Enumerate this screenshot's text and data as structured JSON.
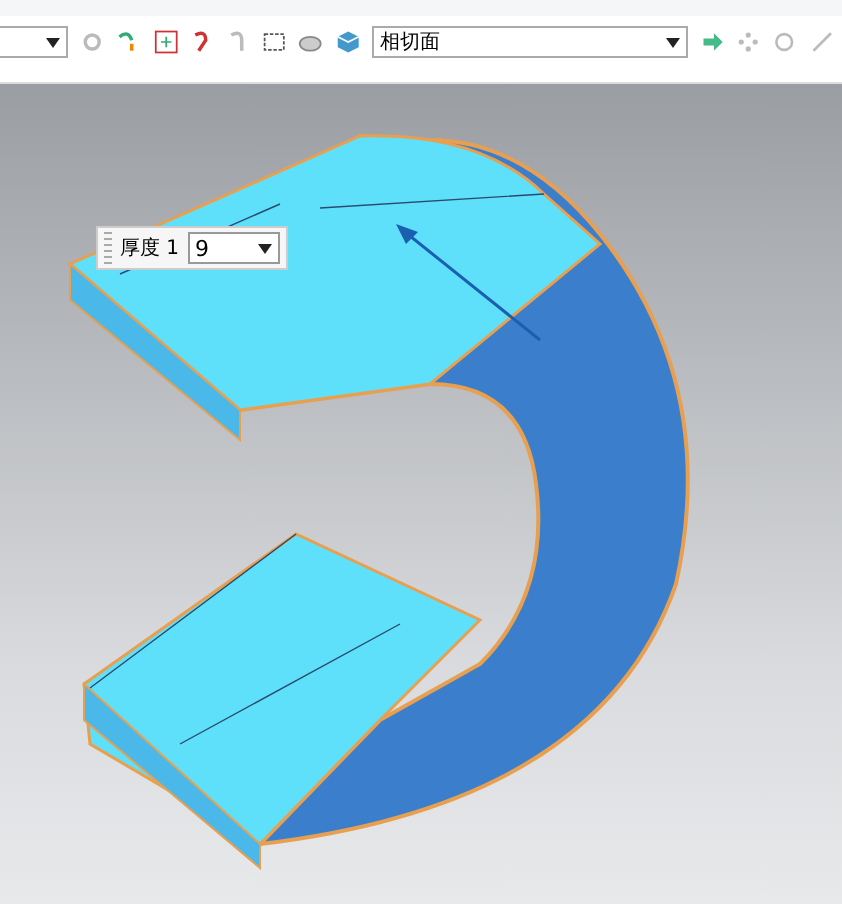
{
  "toolbar": {
    "face_rule_dropdown": {
      "value": "相切面"
    }
  },
  "viewport": {
    "thickness_field": {
      "label": "厚度 1",
      "value": "9"
    }
  }
}
